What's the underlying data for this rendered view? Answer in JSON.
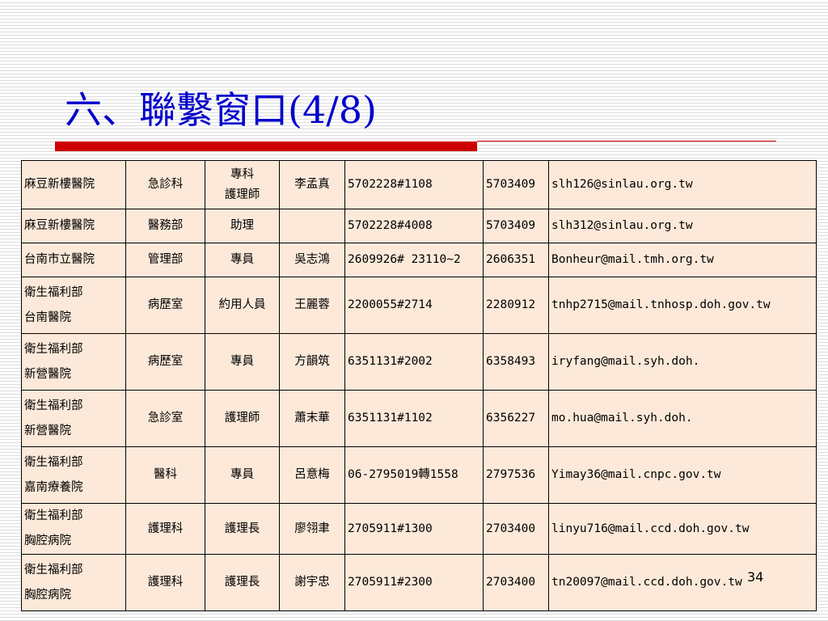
{
  "title": "六、聯繫窗口(4/8)",
  "colors": {
    "title_text": "#0000cc",
    "title_bar": "#cc0000",
    "table_fill": "#fde9d9",
    "table_border": "#000000"
  },
  "contacts": [
    {
      "hospital": "麻豆新樓醫院",
      "department": "急診科",
      "role": "專科\n護理師",
      "name": "李孟真",
      "phone": "5702228#1108",
      "fax": "5703409",
      "email": "slh126@sinlau.org.tw"
    },
    {
      "hospital": "麻豆新樓醫院",
      "department": "醫務部",
      "role": "助理",
      "name": "",
      "phone": "5702228#4008",
      "fax": "5703409",
      "email": "slh312@sinlau.org.tw"
    },
    {
      "hospital": "台南市立醫院",
      "department": "管理部",
      "role": "專員",
      "name": "吳志鴻",
      "phone": "2609926# 23110~2",
      "fax": "2606351",
      "email": "Bonheur@mail.tmh.org.tw"
    },
    {
      "hospital": "衛生福利部\n台南醫院",
      "department": "病歷室",
      "role": "約用人員",
      "name": "王麗蓉",
      "phone": "2200055#2714",
      "fax": "2280912",
      "email": "tnhp2715@mail.tnhosp.doh.gov.tw"
    },
    {
      "hospital": "衛生福利部\n新營醫院",
      "department": "病歷室",
      "role": "專員",
      "name": "方韻筑",
      "phone": "6351131#2002",
      "fax": "6358493",
      "email": "iryfang@mail.syh.doh."
    },
    {
      "hospital": "衛生福利部\n新營醫院",
      "department": "急診室",
      "role": "護理師",
      "name": "蕭末華",
      "phone": "6351131#1102",
      "fax": "6356227",
      "email": "mo.hua@mail.syh.doh."
    },
    {
      "hospital": "衛生福利部\n嘉南療養院",
      "department": "醫科",
      "role": "專員",
      "name": "呂意梅",
      "phone": "06-2795019轉1558",
      "fax": "2797536",
      "email": "Yimay36@mail.cnpc.gov.tw"
    },
    {
      "hospital": "衛生福利部\n胸腔病院",
      "department": "護理科",
      "role": "護理長",
      "name": "廖翎聿",
      "phone": "2705911#1300",
      "fax": "2703400",
      "email": "linyu716@mail.ccd.doh.gov.tw"
    },
    {
      "hospital": "衛生福利部\n胸腔病院",
      "department": "護理科",
      "role": "護理長",
      "name": "謝宇忠",
      "phone": "2705911#2300",
      "fax": "2703400",
      "email": "tn20097@mail.ccd.doh.gov.tw"
    }
  ],
  "page_number": "34"
}
